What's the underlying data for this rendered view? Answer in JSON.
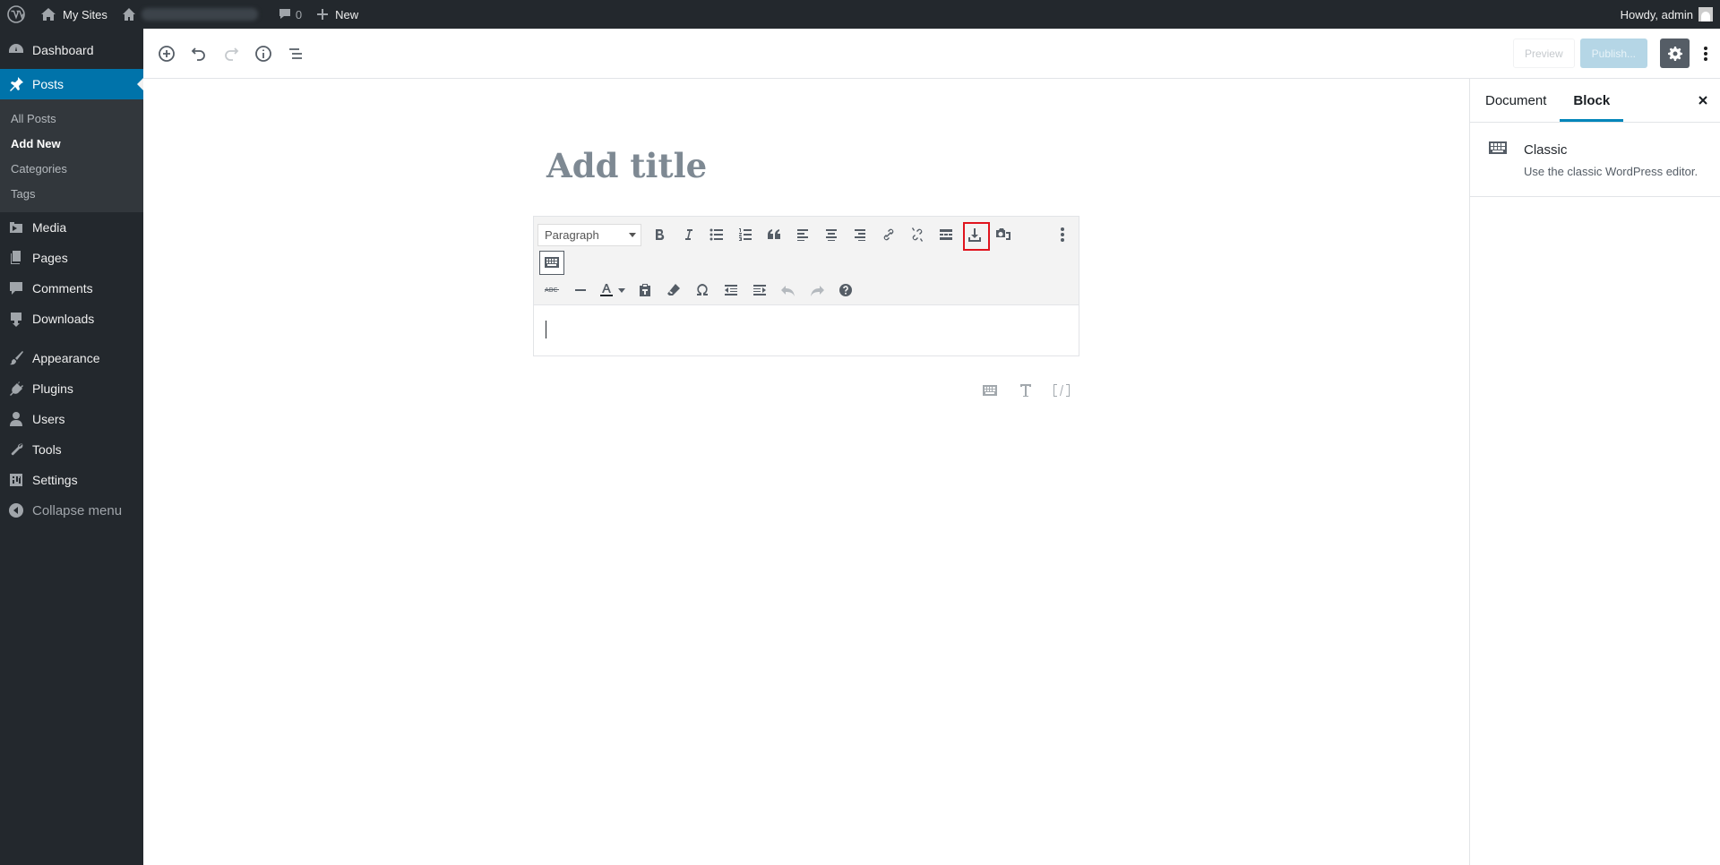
{
  "admin_bar": {
    "my_sites": "My Sites",
    "comments_count": "0",
    "new": "New",
    "howdy": "Howdy, admin"
  },
  "sidebar": {
    "items": [
      {
        "label": "Dashboard",
        "icon": "dashboard-icon"
      },
      {
        "label": "Posts",
        "icon": "pin-icon",
        "current": true
      },
      {
        "label": "Media",
        "icon": "media-icon"
      },
      {
        "label": "Pages",
        "icon": "pages-icon"
      },
      {
        "label": "Comments",
        "icon": "comment-icon"
      },
      {
        "label": "Downloads",
        "icon": "download-icon"
      },
      {
        "label": "Appearance",
        "icon": "brush-icon"
      },
      {
        "label": "Plugins",
        "icon": "plug-icon"
      },
      {
        "label": "Users",
        "icon": "user-icon"
      },
      {
        "label": "Tools",
        "icon": "wrench-icon"
      },
      {
        "label": "Settings",
        "icon": "settings-icon"
      },
      {
        "label": "Collapse menu",
        "icon": "collapse-icon"
      }
    ],
    "posts_submenu": [
      "All Posts",
      "Add New",
      "Categories",
      "Tags"
    ],
    "active_sub": "Add New"
  },
  "header": {
    "preview": "Preview",
    "publish": "Publish..."
  },
  "editor": {
    "title_placeholder": "Add title",
    "format_select": "Paragraph"
  },
  "settings_sidebar": {
    "tabs": [
      "Document",
      "Block"
    ],
    "active_tab": "Block",
    "block_name": "Classic",
    "block_description": "Use the classic WordPress editor."
  },
  "colors": {
    "admin_bg": "#23282d",
    "accent": "#0073aa",
    "highlight_border": "#e0141e"
  }
}
